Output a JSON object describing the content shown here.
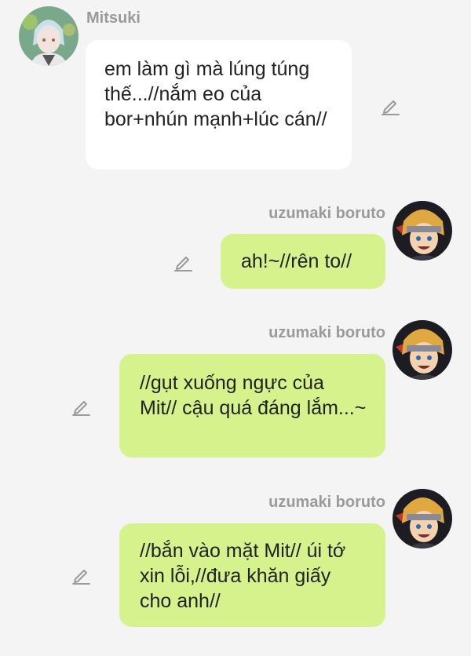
{
  "colors": {
    "background": "#f4f4f4",
    "incoming_bubble": "#ffffff",
    "outgoing_bubble": "#d6f28c",
    "sender_name": "#9a9a9a"
  },
  "messages": [
    {
      "sender": "Mitsuki",
      "direction": "incoming",
      "text": "em làm gì mà lúng túng thế...//nắm eo của bor+nhún mạnh+lúc cán//",
      "icon": "edit-icon"
    },
    {
      "sender": "uzumaki boruto",
      "direction": "outgoing",
      "text": "ah!~//rên to//",
      "icon": "edit-icon"
    },
    {
      "sender": "uzumaki boruto",
      "direction": "outgoing",
      "text": "//gụt xuống ngực của Mit// cậu quá đáng lắm...~",
      "icon": "edit-icon"
    },
    {
      "sender": "uzumaki boruto",
      "direction": "outgoing",
      "text": "//bắn vào mặt Mit// úi tớ xin lỗi,//đưa khăn giấy cho anh//",
      "icon": "edit-icon"
    }
  ]
}
